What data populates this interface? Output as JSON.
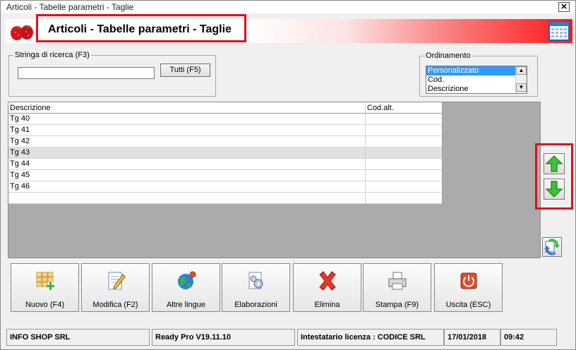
{
  "window": {
    "title": "Articoli - Tabelle parametri - Taglie",
    "close_label": "✕"
  },
  "banner": {
    "title": "Articoli - Tabelle parametri - Taglie"
  },
  "search": {
    "label": "Stringa di ricerca (F3)",
    "value": "",
    "placeholder": "",
    "all_button": "Tutti (F5)"
  },
  "ordering": {
    "label": "Ordinamento",
    "options": [
      "Personalizzato",
      "Cod.",
      "Descrizione"
    ],
    "selected": "Personalizzato"
  },
  "table": {
    "columns": [
      "Descrizione",
      "Cod.alt."
    ],
    "rows": [
      [
        "Tg 40",
        ""
      ],
      [
        "Tg 41",
        ""
      ],
      [
        "Tg 42",
        ""
      ],
      [
        "Tg 43",
        ""
      ],
      [
        "Tg 44",
        ""
      ],
      [
        "Tg 45",
        ""
      ],
      [
        "Tg 46",
        ""
      ],
      [
        "",
        ""
      ]
    ],
    "selected_row": 3
  },
  "toolbar": {
    "buttons": [
      {
        "label": "Nuovo (F4)",
        "icon": "grid-add-icon"
      },
      {
        "label": "Modifica (F2)",
        "icon": "edit-document-icon"
      },
      {
        "label": "Altre lingue",
        "icon": "globe-icon"
      },
      {
        "label": "Elaborazioni",
        "icon": "gear-document-icon"
      },
      {
        "label": "Elimina",
        "icon": "delete-x-icon"
      },
      {
        "label": "Stampa (F9)",
        "icon": "printer-icon"
      },
      {
        "label": "Uscita (ESC)",
        "icon": "power-icon"
      }
    ]
  },
  "status": {
    "company": "INFO SHOP SRL",
    "version": "Ready Pro V19.11.10",
    "license": "Intestatario licenza : CODICE SRL",
    "date": "17/01/2018",
    "time": "09:42"
  },
  "colors": {
    "highlight_box": "#e0101c",
    "selection": "#3399ff",
    "banner_end": "#ff1818"
  }
}
